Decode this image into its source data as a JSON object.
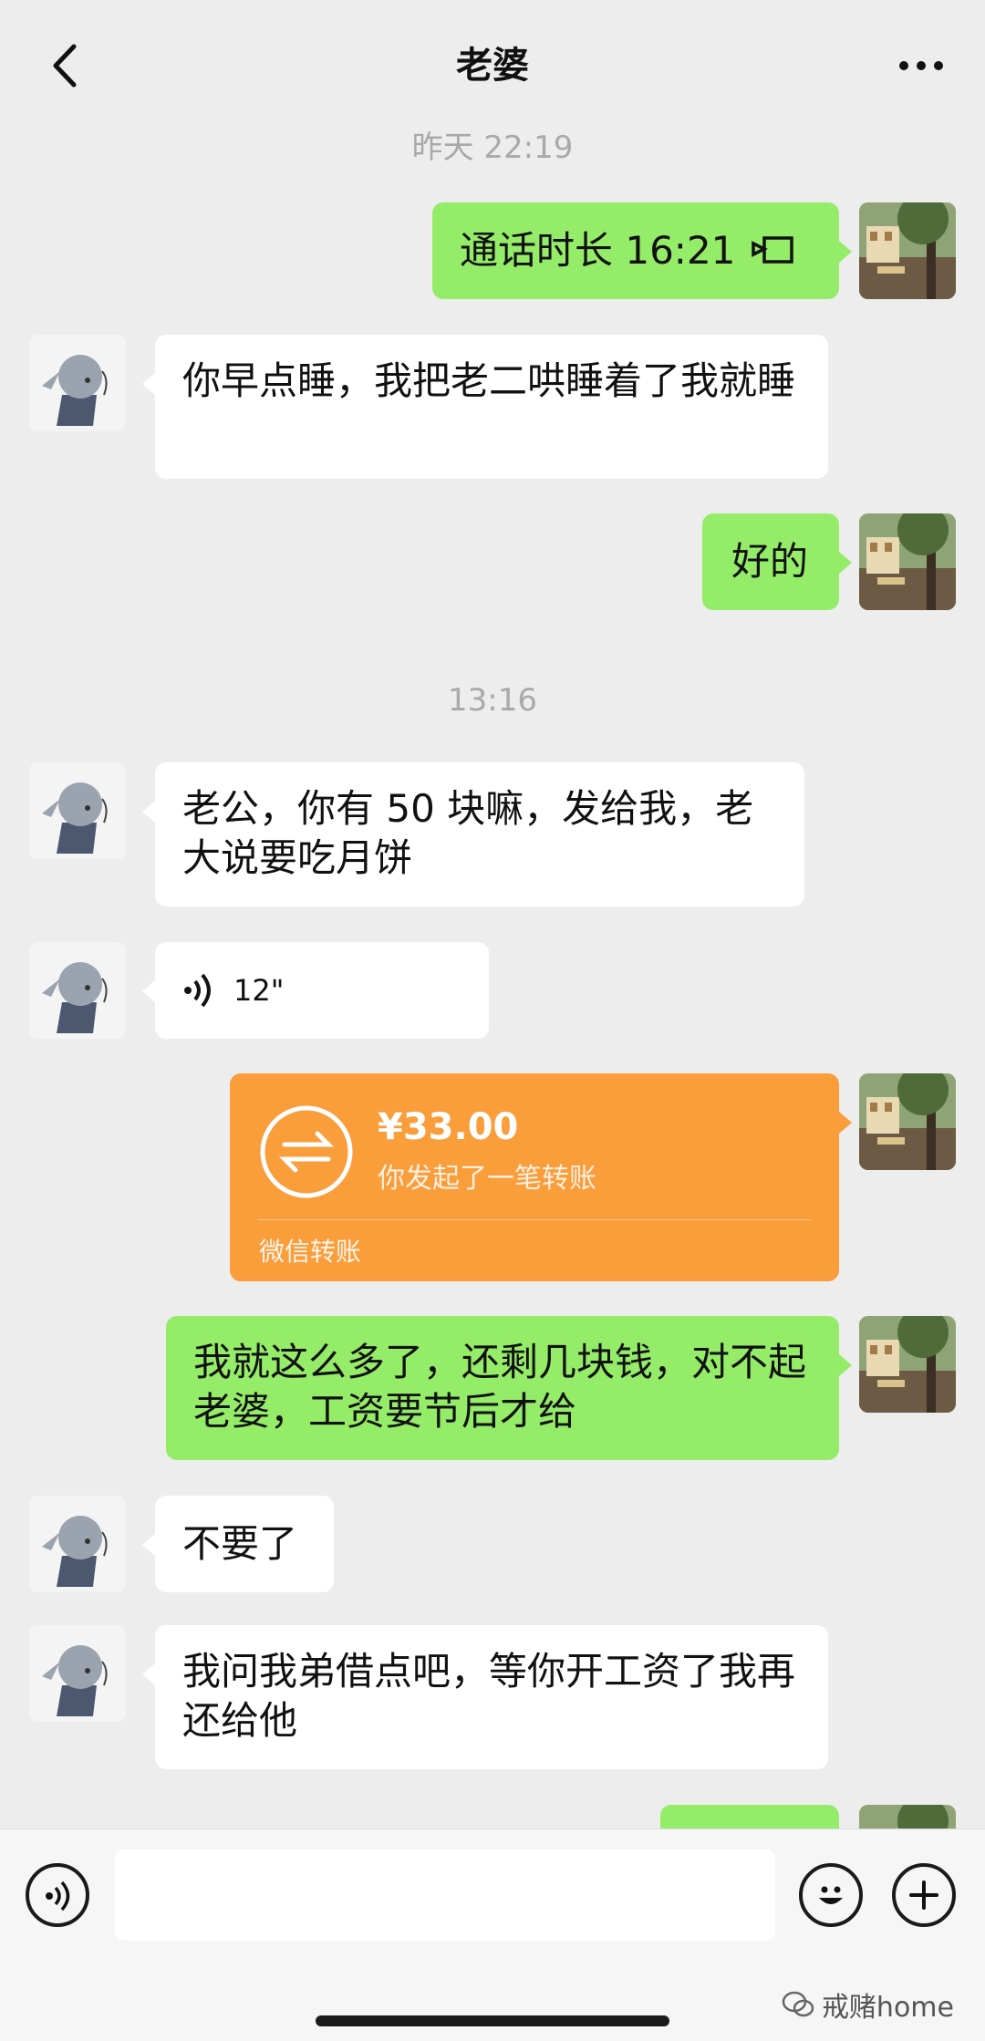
{
  "header": {
    "title": "老婆"
  },
  "timestamps": [
    "昨天 22:19",
    "13:16"
  ],
  "messages": {
    "call": {
      "text": "通话时长 16:21"
    },
    "m1": {
      "text": "你早点睡，我把老二哄睡着了我就睡"
    },
    "m2": {
      "text": "好的"
    },
    "m3": {
      "text": "老公，你有 50 块嘛，发给我，老大说要吃月饼"
    },
    "voice": {
      "duration": "12\""
    },
    "transfer": {
      "amount": "¥33.00",
      "note": "你发起了一笔转账",
      "label": "微信转账"
    },
    "m4": {
      "text": "我就这么多了，还剩几块钱，对不起老婆，工资要节后才给"
    },
    "m5": {
      "text": "不要了"
    },
    "m6": {
      "text": "我问我弟借点吧，等你开工资了我再还给他"
    }
  },
  "watermark": {
    "text": "戒赌home"
  },
  "colors": {
    "background": "#ededed",
    "sent_bubble": "#95ec69",
    "received_bubble": "#ffffff",
    "transfer": "#fa9d3b"
  }
}
